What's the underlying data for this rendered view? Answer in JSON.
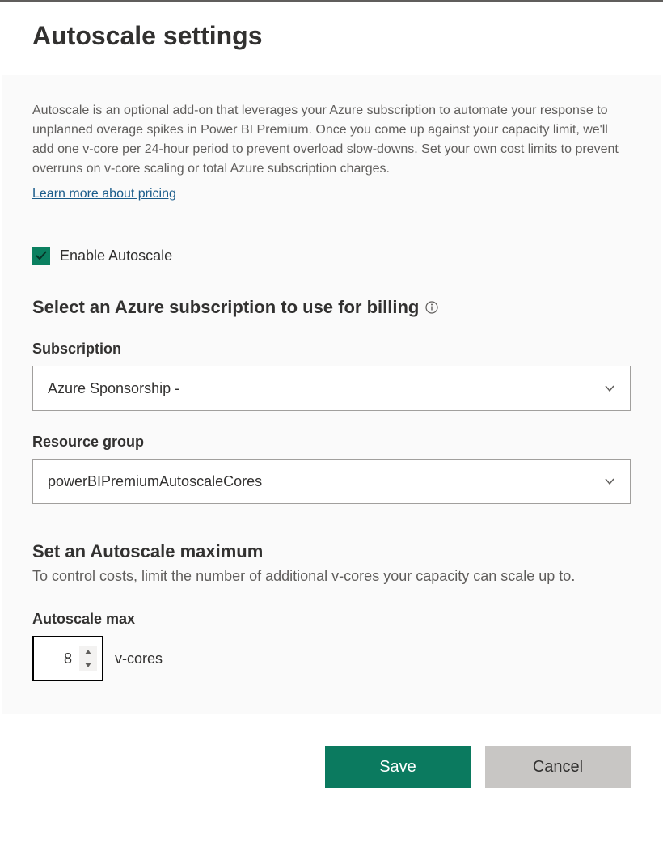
{
  "header": {
    "title": "Autoscale settings"
  },
  "content": {
    "description": "Autoscale is an optional add-on that leverages your Azure subscription to automate your response to unplanned overage spikes in Power BI Premium. Once you come up against your capacity limit, we'll add one v-core per 24-hour period to prevent overload slow-downs. Set your own cost limits to prevent overruns on v-core scaling or total Azure subscription charges.",
    "pricing_link": "Learn more about pricing",
    "enable_label": "Enable Autoscale",
    "billing_title": "Select an Azure subscription to use for billing",
    "subscription": {
      "label": "Subscription",
      "value": "Azure Sponsorship -"
    },
    "resource_group": {
      "label": "Resource group",
      "value": "powerBIPremiumAutoscaleCores"
    },
    "max_section": {
      "title": "Set an Autoscale maximum",
      "subtitle": "To control costs, limit the number of additional v-cores your capacity can scale up to.",
      "label": "Autoscale max",
      "value": "8",
      "unit": "v-cores"
    }
  },
  "footer": {
    "save": "Save",
    "cancel": "Cancel"
  }
}
